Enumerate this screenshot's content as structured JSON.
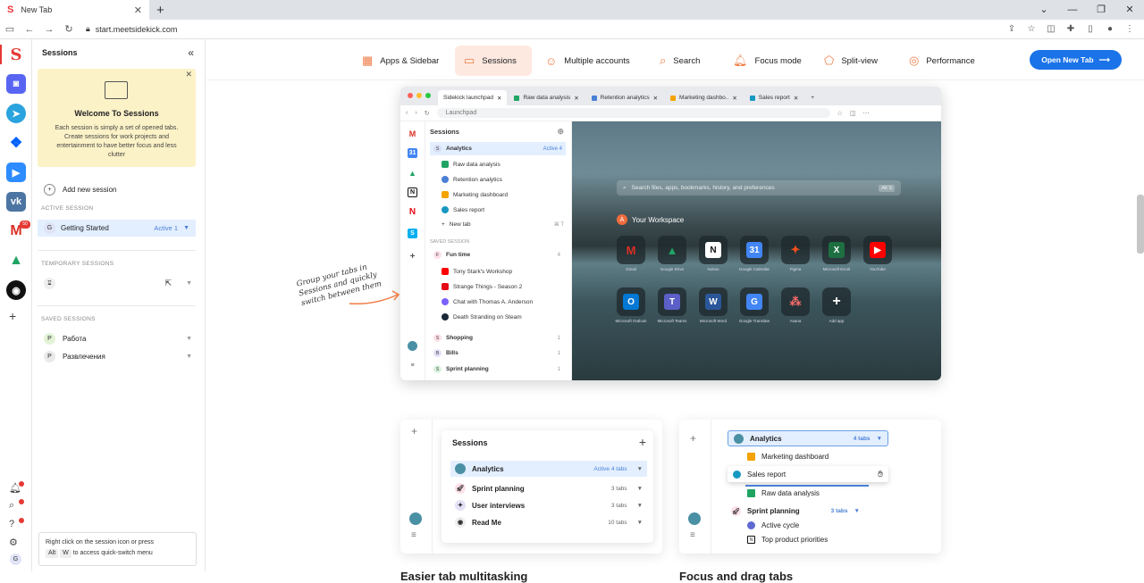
{
  "browser": {
    "tab_title": "New Tab",
    "url": "start.meetsidekick.com"
  },
  "sidebar": {
    "title": "Sessions",
    "welcome": {
      "title": "Welcome To Sessions",
      "description": "Each session is simply a set of opened tabs. Create sessions for work projects and entertainment to have better focus and less clutter"
    },
    "add_session": "Add new session",
    "active_label": "ACTIVE SESSION",
    "active_session": {
      "initial": "G",
      "name": "Getting Started",
      "status": "Active 1"
    },
    "temporary_label": "TEMPORARY SESSIONS",
    "saved_label": "SAVED SESSIONS",
    "saved": [
      {
        "initial": "P",
        "name": "Работа"
      },
      {
        "initial": "P",
        "name": "Развлечения"
      }
    ],
    "tip_line1": "Right click on the session icon or press",
    "tip_key1": "Alt",
    "tip_key2": "W",
    "tip_line2": "to access quick-switch menu",
    "gmail_badge": "50",
    "avatar": "G"
  },
  "nav": {
    "items": [
      "Apps & Sidebar",
      "Sessions",
      "Multiple accounts",
      "Search",
      "Focus mode",
      "Split-view",
      "Performance"
    ],
    "cta": "Open New Tab"
  },
  "preview": {
    "tabs": [
      "Sidekick launchpad",
      "Raw data analysis",
      "Retention analytics",
      "Marketing dashbo..",
      "Sales report"
    ],
    "address": "Launchpad",
    "sessions_title": "Sessions",
    "analytics": {
      "initial": "S",
      "name": "Analytics",
      "status": "Active 4"
    },
    "analytics_tabs": [
      "Raw data analysis",
      "Retention analytics",
      "Marketing dashboard",
      "Sales report"
    ],
    "new_tab": "New tab",
    "new_tab_keys": "⌘  T",
    "saved_label": "SAVED SESSION",
    "fun": {
      "initial": "F",
      "name": "Fun time",
      "count": "4"
    },
    "fun_tabs": [
      "Tony Stark's Workshop",
      "Strange Things - Season 2",
      "Chat with Thomas A. Anderson",
      "Death Stranding on Steam"
    ],
    "others": [
      {
        "initial": "S",
        "name": "Shopping",
        "count": "1"
      },
      {
        "initial": "B",
        "name": "Bills",
        "count": "1"
      },
      {
        "initial": "S",
        "name": "Sprint planning",
        "count": "1"
      }
    ],
    "search_placeholder": "Search files, apps, bookmarks, history, and preferences",
    "search_keys": "Alt  S",
    "workspace": "Your Workspace",
    "workspace_initial": "A",
    "apps_row1": [
      "Gmail",
      "Google Drive",
      "Notion",
      "Google Calendar",
      "Figma",
      "Microsoft Excel",
      "YouTube"
    ],
    "apps_row2": [
      "Microsoft Outlook",
      "Microsoft Teams",
      "Microsoft Word",
      "Google Translate",
      "Asana",
      "Add app"
    ],
    "annotation": "Group your tabs in Sessions and quickly switch between them"
  },
  "card1": {
    "title": "Sessions",
    "rows": [
      {
        "name": "Analytics",
        "meta": "Active  4 tabs"
      },
      {
        "name": "Sprint planning",
        "meta": "3 tabs"
      },
      {
        "name": "User interviews",
        "meta": "3 tabs"
      },
      {
        "name": "Read Me",
        "meta": "10 tabs"
      }
    ]
  },
  "card2": {
    "analytics": "Analytics",
    "analytics_meta": "4 tabs",
    "items": [
      "Marketing dashboard",
      "Sales report",
      "Raw data analysis"
    ],
    "sprint": "Sprint planning",
    "sprint_meta": "3 tabs",
    "sprint_items": [
      "Active cycle",
      "Top product priorities"
    ]
  },
  "headings": [
    "Easier tab multitasking",
    "Focus and drag tabs"
  ]
}
